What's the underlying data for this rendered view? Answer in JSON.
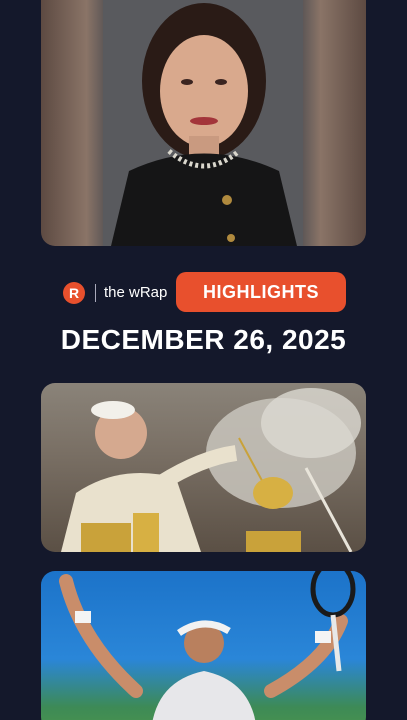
{
  "brand": {
    "logo_letter": "R",
    "program_name": "the wRap",
    "badge_label": "HIGHLIGHTS"
  },
  "date_heading": "DECEMBER 26, 2025",
  "colors": {
    "background": "#14182b",
    "accent": "#e8502d",
    "text": "#ffffff"
  },
  "photos": [
    {
      "subject": "portrait-woman"
    },
    {
      "subject": "pope-incense"
    },
    {
      "subject": "tennis-player"
    }
  ]
}
